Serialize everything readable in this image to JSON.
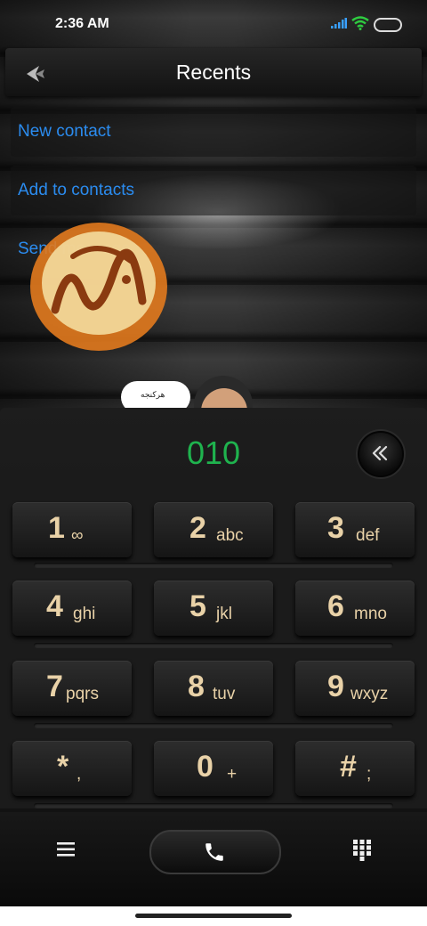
{
  "status_bar": {
    "time": "2:36 AM"
  },
  "header": {
    "title": "Recents"
  },
  "actions": [
    {
      "label": "New contact"
    },
    {
      "label": "Add to contacts"
    },
    {
      "label": "Send message"
    }
  ],
  "dialer": {
    "number": "010"
  },
  "keys": [
    {
      "digit": "1",
      "letters": "∞"
    },
    {
      "digit": "2",
      "letters": "abc"
    },
    {
      "digit": "3",
      "letters": "def"
    },
    {
      "digit": "4",
      "letters": "ghi"
    },
    {
      "digit": "5",
      "letters": "jkl"
    },
    {
      "digit": "6",
      "letters": "mno"
    },
    {
      "digit": "7",
      "letters": "pqrs"
    },
    {
      "digit": "8",
      "letters": "tuv"
    },
    {
      "digit": "9",
      "letters": "wxyz"
    },
    {
      "digit": "*",
      "letters": ","
    },
    {
      "digit": "0",
      "letters": "+"
    },
    {
      "digit": "#",
      "letters": ";"
    }
  ],
  "wallpaper_caption": "هرکنجه",
  "colors": {
    "accent_link": "#2b8cf0",
    "number": "#1fb34e",
    "key_text": "#e9d2a8",
    "logo_orange": "#e27a1e"
  },
  "icons": [
    "signal-icon",
    "wifi-icon",
    "battery-icon",
    "back-icon",
    "backspace-icon",
    "menu-icon",
    "phone-icon",
    "dialpad-icon"
  ]
}
